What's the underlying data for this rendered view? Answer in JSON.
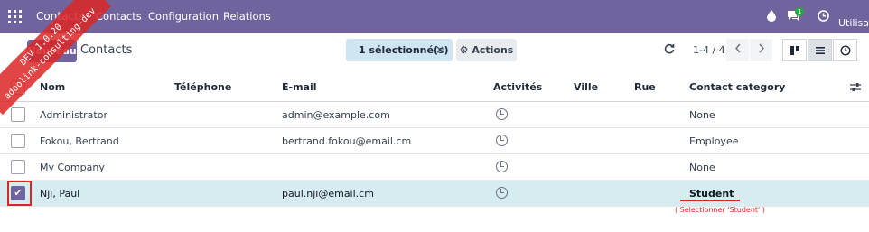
{
  "navbar": {
    "brand": "Contacts",
    "menu": [
      "Contacts",
      "Configuration",
      "Relations"
    ],
    "messages_badge": "1",
    "user_label": "Utilisat"
  },
  "ribbon": {
    "line1": "DEV 1.0.20",
    "line2": "adoolink-consulting-dev"
  },
  "control_panel": {
    "new_button": "Nouveau",
    "breadcrumb": "Contacts",
    "selection": "1 sélectionné(s)",
    "clear_selection": "×",
    "actions": "⚙ Actions",
    "pager": "1-4 / 4"
  },
  "table": {
    "columns": [
      "Nom",
      "Téléphone",
      "E-mail",
      "Activités",
      "Ville",
      "Rue",
      "Contact category"
    ],
    "rows": [
      {
        "name": "Administrator",
        "phone": "",
        "email": "admin@example.com",
        "city": "",
        "street": "",
        "category": "None",
        "selected": false
      },
      {
        "name": "Fokou, Bertrand",
        "phone": "",
        "email": "bertrand.fokou@email.cm",
        "city": "",
        "street": "",
        "category": "Employee",
        "selected": false
      },
      {
        "name": "My Company",
        "phone": "",
        "email": "",
        "city": "",
        "street": "",
        "category": "None",
        "selected": false
      },
      {
        "name": "Nji, Paul",
        "phone": "",
        "email": "paul.nji@email.cm",
        "city": "",
        "street": "",
        "category": "Student",
        "selected": true
      }
    ]
  },
  "annotation": {
    "text": "( Selectionner  'Student' )"
  },
  "colors": {
    "primary": "#71639e",
    "selected_row": "#d6ecf0",
    "annotation": "#dc2626"
  }
}
